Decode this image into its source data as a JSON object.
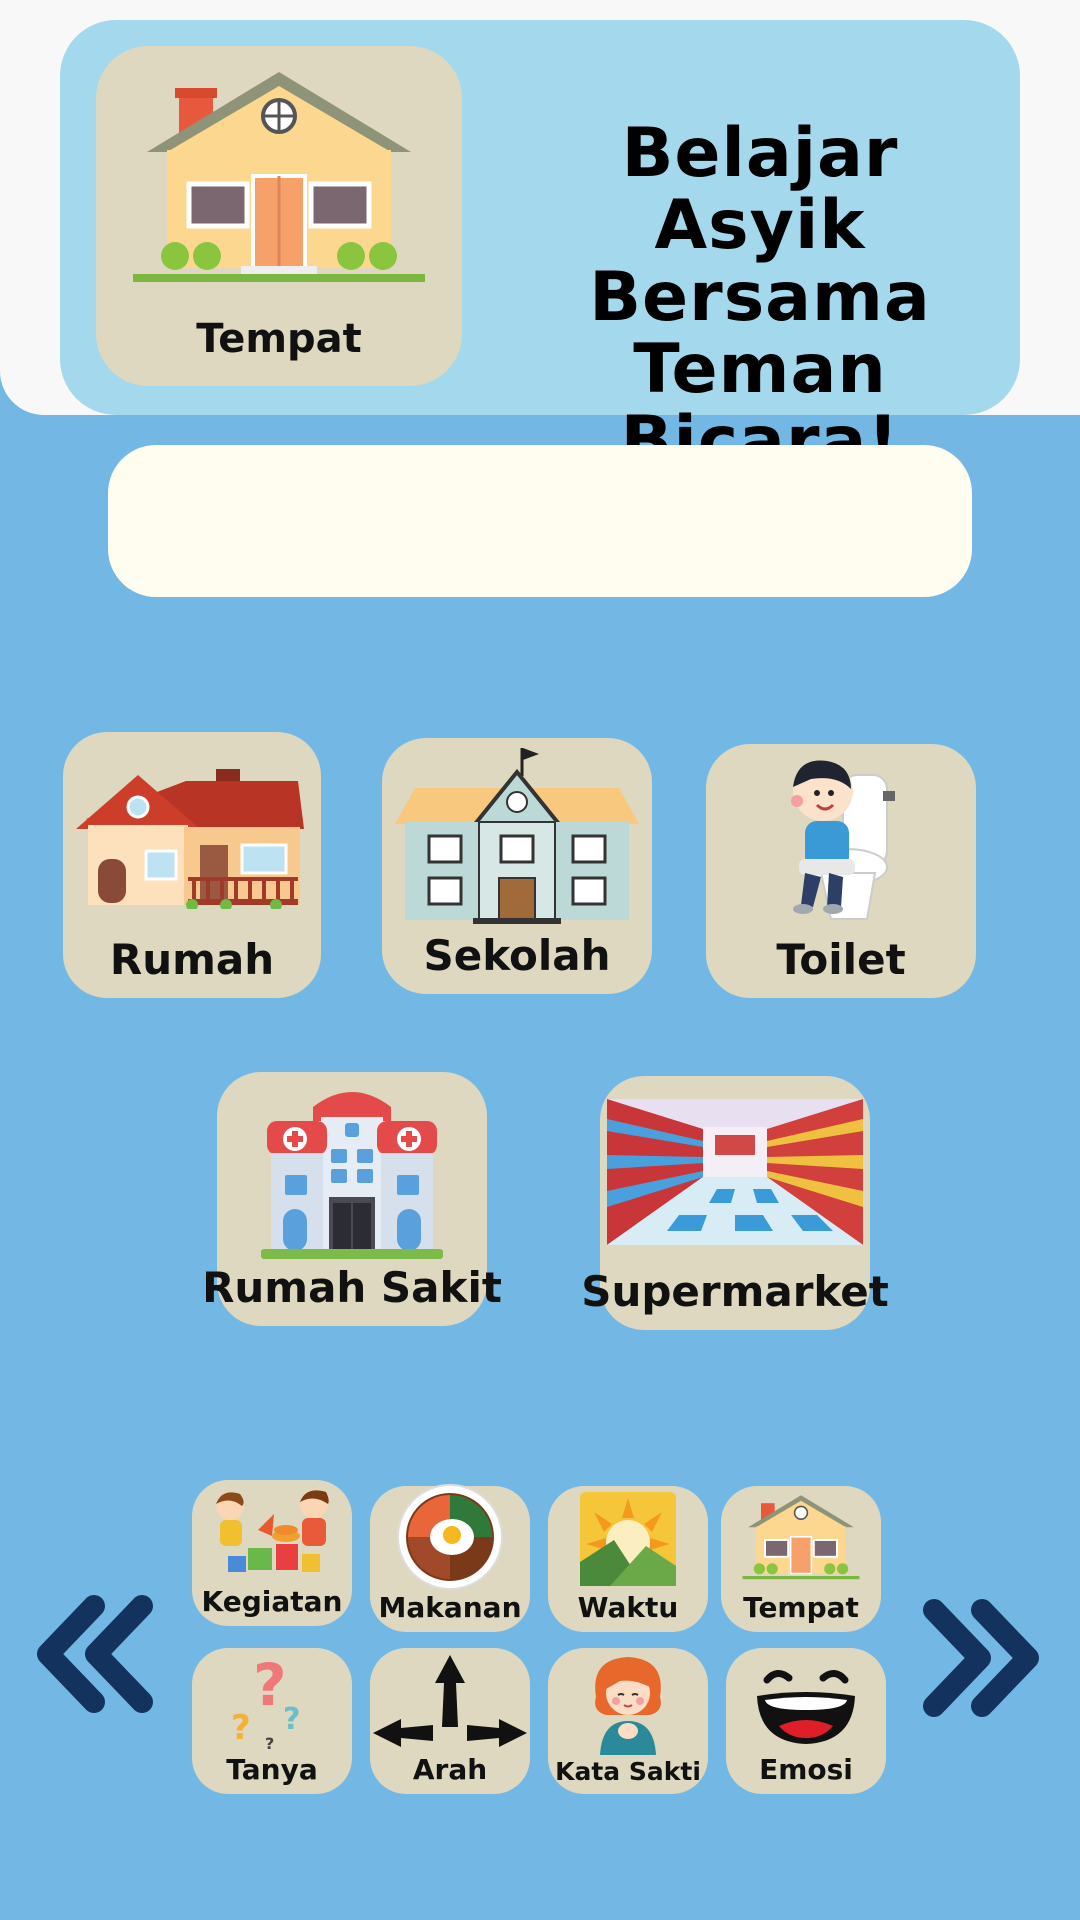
{
  "header": {
    "category": {
      "label": "Tempat",
      "icon": "house-icon"
    },
    "title_lines": [
      "Belajar Asyik",
      "Bersama",
      "Teman Bicara!"
    ]
  },
  "sentence_bar": {
    "text": ""
  },
  "places": [
    {
      "label": "Rumah",
      "icon": "home-icon"
    },
    {
      "label": "Sekolah",
      "icon": "school-icon"
    },
    {
      "label": "Toilet",
      "icon": "toilet-icon"
    },
    {
      "label": "Rumah Sakit",
      "icon": "hospital-icon"
    },
    {
      "label": "Supermarket",
      "icon": "supermarket-icon"
    }
  ],
  "categories": [
    {
      "label": "Kegiatan",
      "icon": "kids-playing-icon"
    },
    {
      "label": "Makanan",
      "icon": "food-plate-icon"
    },
    {
      "label": "Waktu",
      "icon": "sun-icon"
    },
    {
      "label": "Tempat",
      "icon": "house-icon"
    },
    {
      "label": "Tanya",
      "icon": "question-marks-icon"
    },
    {
      "label": "Arah",
      "icon": "directions-icon"
    },
    {
      "label": "Kata Sakti",
      "icon": "girl-icon"
    },
    {
      "label": "Emosi",
      "icon": "laughing-face-icon"
    }
  ],
  "nav": {
    "prev_icon": "double-chevron-left-icon",
    "next_icon": "double-chevron-right-icon"
  },
  "colors": {
    "background": "#73b8e4",
    "header": "#a4d8ec",
    "tile": "#ddd8bf",
    "arrow": "#14325e",
    "sentence_bar": "#fffdf0"
  }
}
